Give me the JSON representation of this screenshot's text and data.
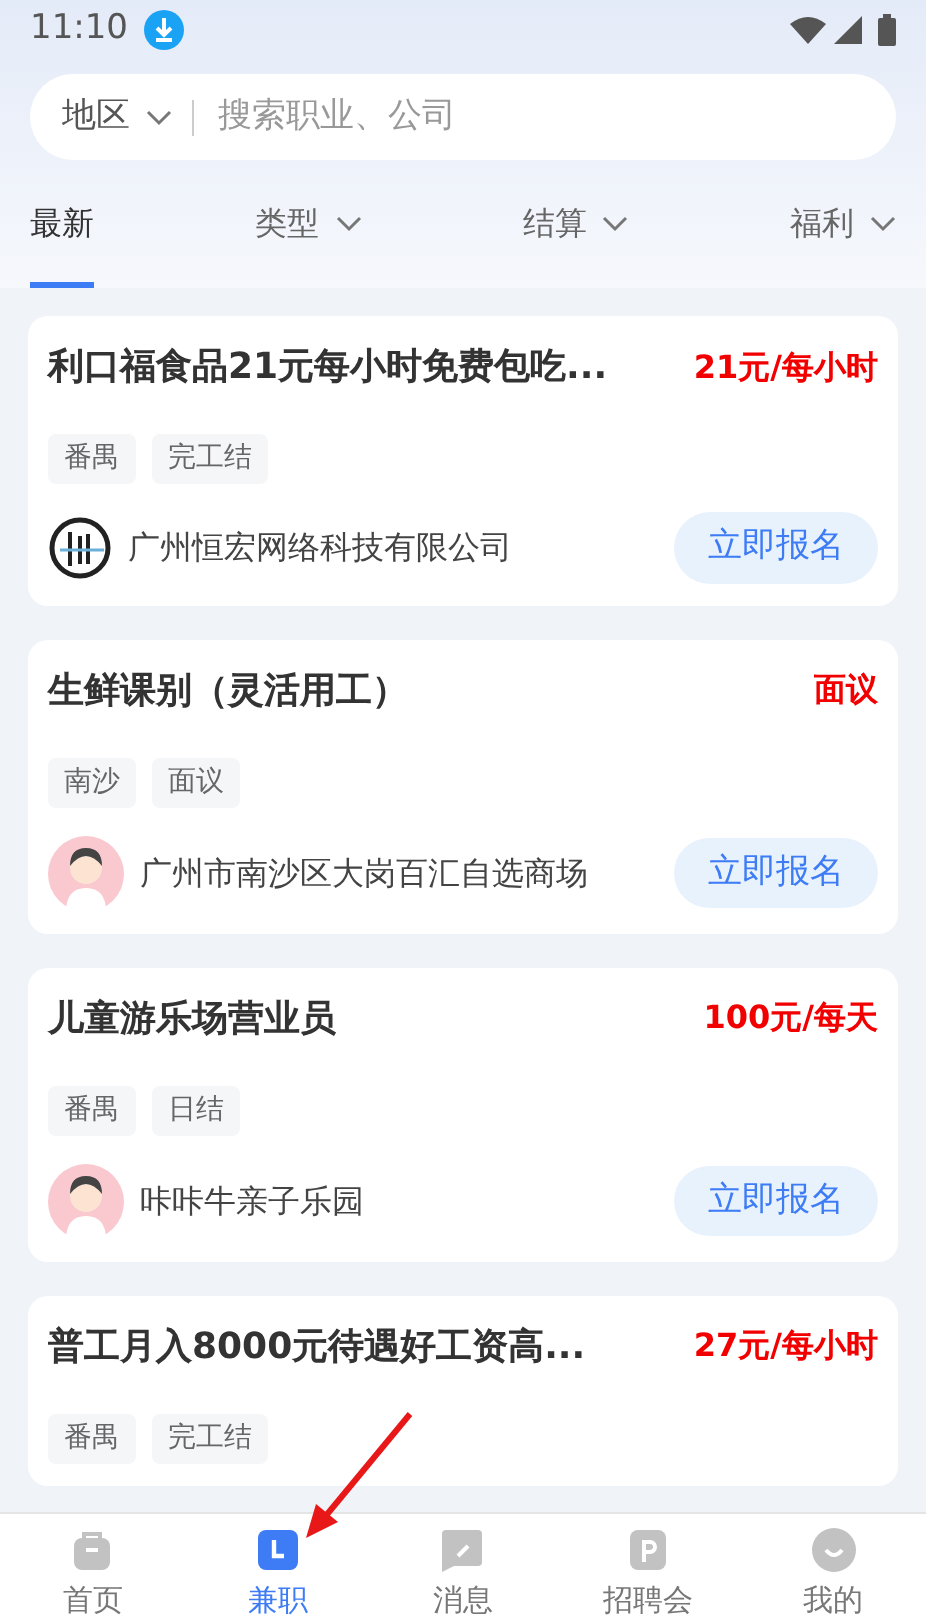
{
  "status_bar": {
    "time": "11:10"
  },
  "search": {
    "region": "地区",
    "placeholder": "搜索职业、公司"
  },
  "filters": [
    {
      "label": "最新",
      "selected": true,
      "dropdown": false
    },
    {
      "label": "类型",
      "selected": false,
      "dropdown": true
    },
    {
      "label": "结算",
      "selected": false,
      "dropdown": true
    },
    {
      "label": "福利",
      "selected": false,
      "dropdown": true
    }
  ],
  "jobs": [
    {
      "title": "利口福食品21元每小时免费包吃...",
      "pay": "21元/每小时",
      "tags": [
        "番禺",
        "完工结"
      ],
      "company": "广州恒宏网络科技有限公司",
      "kind": "logo",
      "action": "立即报名"
    },
    {
      "title": "生鲜课别（灵活用工）",
      "pay": "面议",
      "tags": [
        "南沙",
        "面议"
      ],
      "company": "广州市南沙区大岗百汇自选商场",
      "kind": "figure",
      "action": "立即报名"
    },
    {
      "title": "儿童游乐场营业员",
      "pay": "100元/每天",
      "tags": [
        "番禺",
        "日结"
      ],
      "company": "咔咔牛亲子乐园",
      "kind": "figure",
      "action": "立即报名"
    },
    {
      "title": "普工月入8000元待遇好工资高...",
      "pay": "27元/每小时",
      "tags": [
        "番禺",
        "完工结"
      ]
    }
  ],
  "nav": [
    {
      "label": "首页",
      "selected": false
    },
    {
      "label": "兼职",
      "selected": true
    },
    {
      "label": "消息",
      "selected": false
    },
    {
      "label": "招聘会",
      "selected": false
    },
    {
      "label": "我的",
      "selected": false
    }
  ],
  "annotation": {
    "kind": "arrow"
  }
}
